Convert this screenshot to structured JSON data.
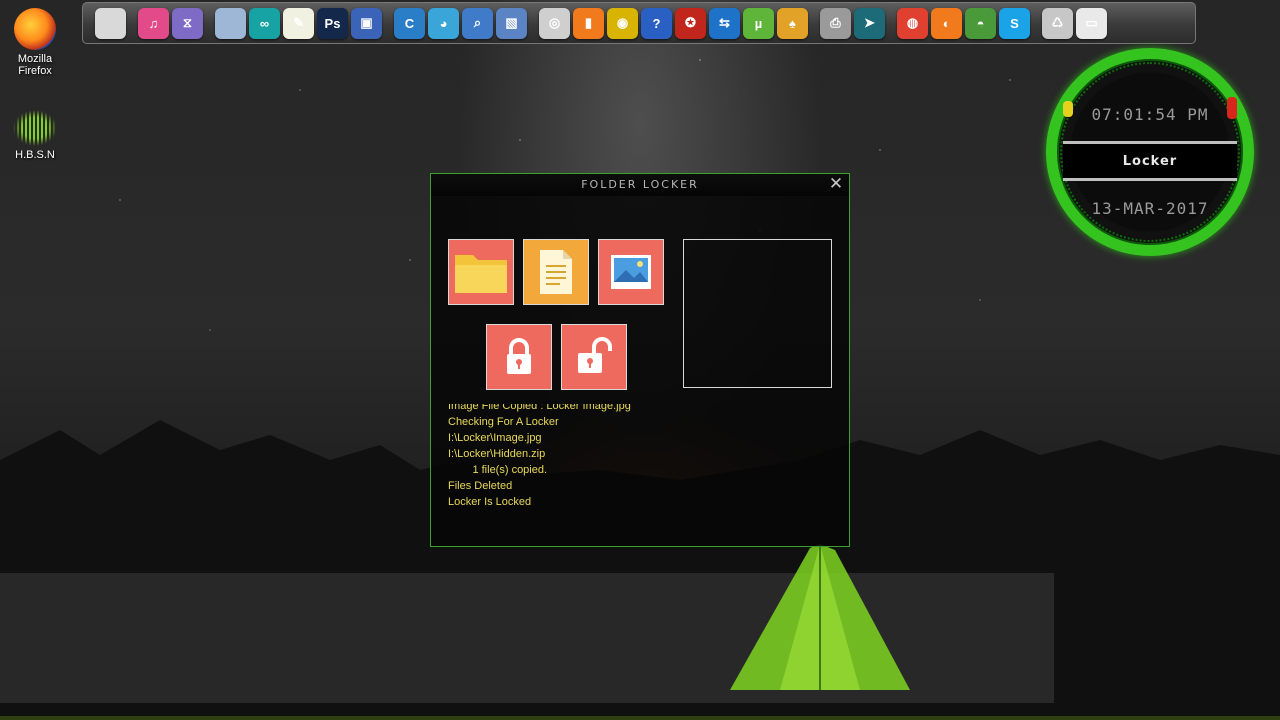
{
  "desktop": {
    "icons": [
      {
        "label": "Mozilla Firefox"
      },
      {
        "label": "H.B.S.N"
      }
    ]
  },
  "dock": {
    "items": [
      {
        "name": "system-icon",
        "glyph": "",
        "color": "#d9d9d9"
      },
      {
        "name": "itunes-icon",
        "glyph": "♫",
        "color": "#e24a8a"
      },
      {
        "name": "visual-studio-icon",
        "glyph": "⧖",
        "color": "#7d6bc6"
      },
      {
        "name": "virtualbox-cube-icon",
        "glyph": "",
        "color": "#9fb7d6"
      },
      {
        "name": "arduino-icon",
        "glyph": "∞",
        "color": "#17a3a3"
      },
      {
        "name": "notepad-icon",
        "glyph": "✎",
        "color": "#f1f1e2"
      },
      {
        "name": "photoshop-icon",
        "glyph": "Ps",
        "color": "#13284a"
      },
      {
        "name": "network-computer-icon",
        "glyph": "▣",
        "color": "#3b63b7"
      },
      {
        "name": "eclipse-icon",
        "glyph": "C",
        "color": "#2a7dc7"
      },
      {
        "name": "browser-shield-icon",
        "glyph": "◕",
        "color": "#3aa5d8"
      },
      {
        "name": "photo-tools-icon",
        "glyph": "⌕",
        "color": "#3f7bc9"
      },
      {
        "name": "virtualbox-icon",
        "glyph": "▧",
        "color": "#5b84c4"
      },
      {
        "name": "disk-utility-icon",
        "glyph": "◎",
        "color": "#cfcfcf"
      },
      {
        "name": "bar-chart-app-icon",
        "glyph": "▮",
        "color": "#f07a1c"
      },
      {
        "name": "cd-burner-icon",
        "glyph": "◉",
        "color": "#d8b400"
      },
      {
        "name": "help-icon",
        "glyph": "?",
        "color": "#2a5fc4"
      },
      {
        "name": "antivirus-icon",
        "glyph": "✪",
        "color": "#c0261c"
      },
      {
        "name": "teamviewer-icon",
        "glyph": "⇆",
        "color": "#1e72c8"
      },
      {
        "name": "utorrent-icon",
        "glyph": "µ",
        "color": "#5fb53a"
      },
      {
        "name": "ant-downloader-icon",
        "glyph": "♠",
        "color": "#e2a127"
      },
      {
        "name": "printer-icon",
        "glyph": "⎙",
        "color": "#9a9a9a"
      },
      {
        "name": "arrow-app-icon",
        "glyph": "➤",
        "color": "#1d6a78"
      },
      {
        "name": "chrome-icon",
        "glyph": "◍",
        "color": "#e0402f"
      },
      {
        "name": "firefox-icon",
        "glyph": "◐",
        "color": "#f07a1c"
      },
      {
        "name": "globe-icon",
        "glyph": "◓",
        "color": "#4a9a3a"
      },
      {
        "name": "skype-icon",
        "glyph": "S",
        "color": "#1aa3e6"
      },
      {
        "name": "recycle-bin-icon",
        "glyph": "♺",
        "color": "#c7c7c7"
      },
      {
        "name": "show-desktop-icon",
        "glyph": "▭",
        "color": "#e9e9e9"
      }
    ]
  },
  "clock": {
    "time": "07:01:54 PM",
    "label": "Locker",
    "date": "13-MAR-2017"
  },
  "window": {
    "title": "FOLDER LOCKER",
    "close_glyph": "✕",
    "log": [
      "Image File Copied : Locker Image.jpg",
      "Checking For A Locker",
      "I:\\Locker\\Image.jpg",
      "I:\\Locker\\Hidden.zip",
      "        1 file(s) copied.",
      "Files Deleted",
      "Locker Is Locked"
    ]
  },
  "colors": {
    "accent_green": "#35c320",
    "tile_red": "#ee6a5f",
    "tile_orange": "#f2a83b",
    "log_text": "#e8d95a"
  }
}
